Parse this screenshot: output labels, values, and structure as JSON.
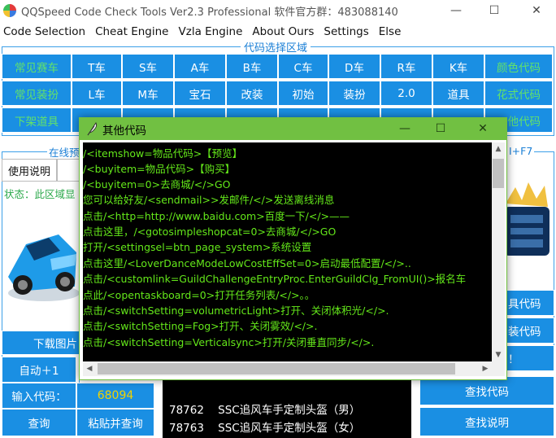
{
  "window": {
    "title": "QQSpeed Code Check Tools Ver2.3 Professional 软件官方群：483088140",
    "minimize": "—",
    "maximize": "☐",
    "close": "✕"
  },
  "menu": [
    "Code Selection",
    "Cheat Engine",
    "Vzla Engine",
    "About Ours",
    "Settings",
    "Else"
  ],
  "code_selection": {
    "legend": "代码选择区域",
    "rows": [
      [
        "常见赛车",
        "T车",
        "S车",
        "A车",
        "B车",
        "C车",
        "D车",
        "R车",
        "K车",
        "颜色代码"
      ],
      [
        "常见装扮",
        "L车",
        "M车",
        "宝石",
        "改装",
        "初始",
        "装扮",
        "2.0",
        "道具",
        "花式代码"
      ],
      [
        "下架道具",
        "",
        "",
        "",
        "",
        "",
        "",
        "",
        "",
        "他代码"
      ]
    ]
  },
  "left_panel": {
    "legend_fragment": "在线预",
    "usage_button": "使用说明",
    "status_text": "状态：此区域显",
    "download_image": "下载图片",
    "auto_plus": "自动＋1",
    "input_label": "输入代码：",
    "input_value": "68094",
    "query_button": "查询",
    "paste_query_button": "粘贴并查询"
  },
  "right_panel": {
    "hotkey_fragment": "I+F7",
    "btn_fragment_1": "具代码",
    "btn_fragment_2": "装代码",
    "btn_fragment_3": "！",
    "find_code": "查找代码",
    "find_help": "查找说明"
  },
  "result_list": [
    {
      "code": "78762",
      "name": "SSC追风车手定制头盔（男）"
    },
    {
      "code": "78763",
      "name": "SSC追风车手定制头盔（女）"
    }
  ],
  "dialog": {
    "title": "其他代码",
    "minimize": "—",
    "maximize": "☐",
    "close": "✕",
    "lines": [
      "/<itemshow=物品代码>【预览】",
      "/<buyitem=物品代码>【购买】",
      "/<buyitem=0>去商城/</>GO",
      "您可以给好友/<sendmail>>发邮件/</>发送离线消息",
      "点击/<http=http://www.baidu.com>百度一下/</>——",
      "点击这里，/<gotosimpleshopcat=0>去商城/</>GO",
      "打开/<settingsel=btn_page_system>系统设置",
      "点击这里/<LoverDanceModeLowCostEffSet=0>启动最低配置/</>..",
      "点击/<customlink=GuildChallengeEntryProc.EnterGuildClg_FromUI()>报名车",
      "点此/<opentaskboard=0>打开任务列表/</>。。",
      "点击/<switchSetting=volumetricLight>打开、关闭体积光/</>.",
      "点击/<switchSetting=Fog>打开、关闭雾效/</>.",
      "点击/<switchSetting=Verticalsync>打开/关闭垂直同步/</>."
    ]
  },
  "colors": {
    "button_blue": "#1a8fe3",
    "button_green_text": "#63e26a",
    "dialog_title_green": "#71c042",
    "code_text_green": "#64e81a",
    "console_black": "#000000",
    "input_value_yellow": "#f2d200"
  }
}
